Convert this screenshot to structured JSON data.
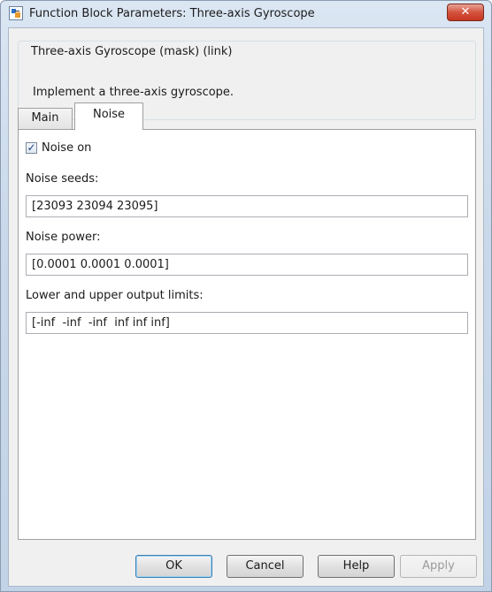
{
  "window": {
    "title": "Function Block Parameters: Three-axis Gyroscope",
    "close_glyph": "✕"
  },
  "block": {
    "name": "Three-axis Gyroscope (mask) (link)",
    "description": "Implement a three-axis gyroscope."
  },
  "tabs": [
    {
      "label": "Main",
      "active": false
    },
    {
      "label": "Noise",
      "active": true
    }
  ],
  "noise": {
    "noise_on_label": "Noise on",
    "noise_on_checked": true,
    "check_glyph": "✓",
    "seeds_label": "Noise seeds:",
    "seeds_value": "[23093 23094 23095]",
    "power_label": "Noise power:",
    "power_value": "[0.0001 0.0001 0.0001]",
    "limits_label": "Lower and upper output limits:",
    "limits_value": "[-inf  -inf  -inf  inf inf inf]"
  },
  "buttons": {
    "ok": "OK",
    "cancel": "Cancel",
    "help": "Help",
    "apply": "Apply",
    "apply_enabled": false
  },
  "colors": {
    "close_button": "#c7361f",
    "ok_focus": "#3c7fb1"
  }
}
